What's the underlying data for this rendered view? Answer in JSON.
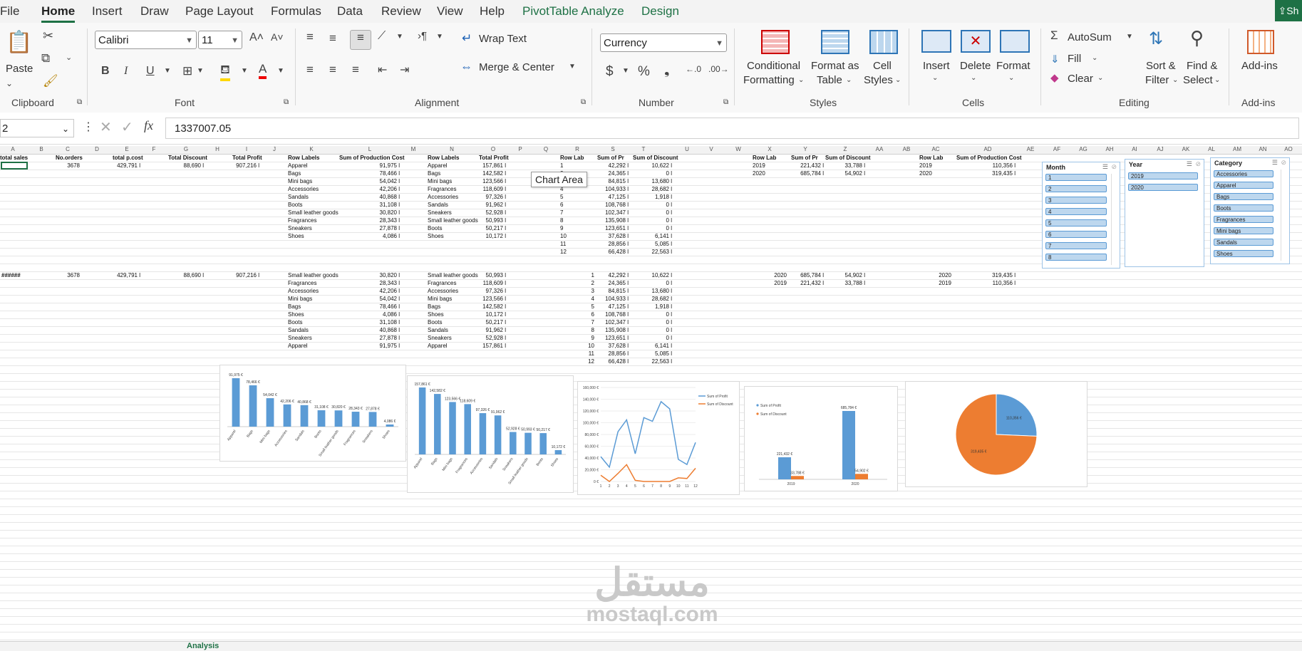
{
  "menu": {
    "items": [
      "File",
      "Home",
      "Insert",
      "Draw",
      "Page Layout",
      "Formulas",
      "Data",
      "Review",
      "View",
      "Help",
      "PivotTable Analyze",
      "Design"
    ],
    "share": "Sh"
  },
  "ribbon": {
    "clipboard": {
      "paste": "Paste",
      "label": "Clipboard"
    },
    "font": {
      "name": "Calibri",
      "size": "11",
      "label": "Font"
    },
    "alignment": {
      "wrap": "Wrap Text",
      "merge": "Merge & Center",
      "label": "Alignment"
    },
    "number": {
      "format": "Currency",
      "label": "Number"
    },
    "styles": {
      "conditional1": "Conditional",
      "conditional2": "Formatting",
      "table1": "Format as",
      "table2": "Table",
      "cell1": "Cell",
      "cell2": "Styles",
      "label": "Styles"
    },
    "cells": {
      "insert": "Insert",
      "delete": "Delete",
      "format": "Format",
      "label": "Cells"
    },
    "editing": {
      "autosum": "AutoSum",
      "fill": "Fill",
      "clear": "Clear",
      "sort1": "Sort &",
      "sort2": "Filter",
      "find1": "Find &",
      "find2": "Select",
      "label": "Editing"
    },
    "addins": {
      "button": "Add-ins",
      "label": "Add-ins"
    }
  },
  "formula_bar": {
    "namebox": "2",
    "value": "1337007.05"
  },
  "columns": [
    "A",
    "B",
    "C",
    "D",
    "E",
    "F",
    "G",
    "H",
    "I",
    "J",
    "K",
    "L",
    "M",
    "N",
    "O",
    "P",
    "Q",
    "R",
    "S",
    "T",
    "U",
    "V",
    "W",
    "X",
    "Y",
    "Z",
    "AA",
    "AB",
    "AC",
    "AD",
    "AE",
    "AF",
    "AG",
    "AH",
    "AI",
    "AJ",
    "AK",
    "AL",
    "AM",
    "AN",
    "AO"
  ],
  "summary": {
    "headers": [
      "total sales",
      "No.orders",
      "total p.cost",
      "Total Discount",
      "Total Profit"
    ],
    "row1": [
      "",
      "3678",
      "429,791 l",
      "88,690 l",
      "907,216 l"
    ],
    "row2": [
      "######",
      "3678",
      "429,791 l",
      "88,690 l",
      "907,216 l"
    ]
  },
  "pivot1": {
    "headers": [
      "Row Labels",
      "Sum of  Production Cost"
    ],
    "rows": [
      [
        "Apparel",
        "91,975 l"
      ],
      [
        "Bags",
        "78,466 l"
      ],
      [
        "Mini bags",
        "54,042 l"
      ],
      [
        "Accessories",
        "42,206 l"
      ],
      [
        "Sandals",
        "40,868 l"
      ],
      [
        "Boots",
        "31,108 l"
      ],
      [
        "Small leather goods",
        "30,820 l"
      ],
      [
        "Fragrances",
        "28,343 l"
      ],
      [
        "Sneakers",
        "27,878 l"
      ],
      [
        "Shoes",
        "4,086 l"
      ]
    ],
    "rows_sorted": [
      [
        "Small leather goods",
        "30,820 l"
      ],
      [
        "Fragrances",
        "28,343 l"
      ],
      [
        "Accessories",
        "42,206 l"
      ],
      [
        "Mini bags",
        "54,042 l"
      ],
      [
        "Bags",
        "78,466 l"
      ],
      [
        "Shoes",
        "4,086 l"
      ],
      [
        "Boots",
        "31,108 l"
      ],
      [
        "Sandals",
        "40,868 l"
      ],
      [
        "Sneakers",
        "27,878 l"
      ],
      [
        "Apparel",
        "91,975 l"
      ]
    ]
  },
  "pivot2": {
    "headers": [
      "Row Labels",
      "Total Profit"
    ],
    "rows": [
      [
        "Apparel",
        "157,861 l"
      ],
      [
        "Bags",
        "142,582 l"
      ],
      [
        "Mini bags",
        "123,566 l"
      ],
      [
        "Fragrances",
        "118,609 l"
      ],
      [
        "Accessories",
        "97,326 l"
      ],
      [
        "Sandals",
        "91,962 l"
      ],
      [
        "Sneakers",
        "52,928 l"
      ],
      [
        "Small leather goods",
        "50,993 l"
      ],
      [
        "Boots",
        "50,217 l"
      ],
      [
        "Shoes",
        "10,172 l"
      ]
    ],
    "rows_sorted": [
      [
        "Small leather goods",
        "50,993 l"
      ],
      [
        "Fragrances",
        "118,609 l"
      ],
      [
        "Accessories",
        "97,326 l"
      ],
      [
        "Mini bags",
        "123,566 l"
      ],
      [
        "Bags",
        "142,582 l"
      ],
      [
        "Shoes",
        "10,172 l"
      ],
      [
        "Boots",
        "50,217 l"
      ],
      [
        "Sandals",
        "91,962 l"
      ],
      [
        "Sneakers",
        "52,928 l"
      ],
      [
        "Apparel",
        "157,861 l"
      ]
    ]
  },
  "pivot3": {
    "headers": [
      "Row Lab",
      "Sum of Pr",
      "Sum of Discount"
    ],
    "rows": [
      [
        "1",
        "42,292 l",
        "10,622 l"
      ],
      [
        "2",
        "24,365 l",
        "0 l"
      ],
      [
        "3",
        "84,815 l",
        "13,680 l"
      ],
      [
        "4",
        "104,933 l",
        "28,682 l"
      ],
      [
        "5",
        "47,125 l",
        "1,918 l"
      ],
      [
        "6",
        "108,768 l",
        "0 l"
      ],
      [
        "7",
        "102,347 l",
        "0 l"
      ],
      [
        "8",
        "135,908 l",
        "0 l"
      ],
      [
        "9",
        "123,651 l",
        "0 l"
      ],
      [
        "10",
        "37,628 l",
        "6,141 l"
      ],
      [
        "11",
        "28,856 l",
        "5,085 l"
      ],
      [
        "12",
        "66,428 l",
        "22,563 l"
      ]
    ]
  },
  "pivot4": {
    "headers": [
      "Row Lab",
      "Sum of Pr",
      "Sum of Discount"
    ],
    "rows": [
      [
        "2019",
        "221,432 l",
        "33,788 l"
      ],
      [
        "2020",
        "685,784 l",
        "54,902 l"
      ]
    ],
    "rows2": [
      [
        "2020",
        "685,784 l",
        "54,902 l"
      ],
      [
        "2019",
        "221,432 l",
        "33,788 l"
      ]
    ]
  },
  "pivot5": {
    "headers": [
      "Row Lab",
      "Sum of  Production Cost"
    ],
    "rows": [
      [
        "2019",
        "110,356 l"
      ],
      [
        "2020",
        "319,435 l"
      ]
    ],
    "rows2": [
      [
        "2020",
        "319,435 l"
      ],
      [
        "2019",
        "110,356 l"
      ]
    ]
  },
  "tooltip": "Chart Area",
  "slicers": {
    "month": {
      "title": "Month",
      "items": [
        "1",
        "2",
        "3",
        "4",
        "5",
        "6",
        "7",
        "8"
      ]
    },
    "year": {
      "title": "Year",
      "items": [
        "2019",
        "2020"
      ]
    },
    "category": {
      "title": "Category",
      "items": [
        "Accessories",
        "Apparel",
        "Bags",
        "Boots",
        "Fragrances",
        "Mini bags",
        "Sandals",
        "Shoes"
      ]
    }
  },
  "charts": [
    {
      "type": "bar",
      "categories": [
        "Apparel",
        "Bags",
        "Mini bags",
        "Accessories",
        "Sandals",
        "Boots",
        "Small leather goods",
        "Fragrances",
        "Sneakers",
        "Shoes"
      ],
      "values": [
        91975,
        78466,
        54042,
        42206,
        40868,
        31108,
        30820,
        28343,
        27878,
        4086
      ],
      "labels": [
        "91,975 €",
        "78,466 €",
        "54,042 €",
        "42,206 €",
        "40,868 €",
        "31,108 €",
        "30,820 €",
        "28,343 €",
        "27,878 €",
        "4,086 €"
      ],
      "color": "#5b9bd5"
    },
    {
      "type": "bar",
      "categories": [
        "Apparel",
        "Bags",
        "Mini bags",
        "Fragrances",
        "Accessories",
        "Sandals",
        "Sneakers",
        "Small leather goods",
        "Boots",
        "Shoes"
      ],
      "values": [
        157861,
        142582,
        123566,
        118609,
        97326,
        91962,
        52928,
        50993,
        50217,
        10172
      ],
      "labels": [
        "157,861 €",
        "142,582 €",
        "123,566 €",
        "118,609 €",
        "97,326 €",
        "91,962 €",
        "52,928 €",
        "50,993 €",
        "50,217 €",
        "10,172 €"
      ],
      "color": "#5b9bd5"
    },
    {
      "type": "line",
      "x": [
        "1",
        "2",
        "3",
        "4",
        "5",
        "6",
        "7",
        "8",
        "9",
        "10",
        "11",
        "12"
      ],
      "series": [
        {
          "name": "Sum of Profit",
          "values": [
            42292,
            24365,
            84815,
            104933,
            47125,
            108768,
            102347,
            135908,
            123651,
            37628,
            28856,
            66428
          ],
          "color": "#5b9bd5"
        },
        {
          "name": "Sum of Discount",
          "values": [
            10622,
            0,
            13680,
            28682,
            1918,
            0,
            0,
            0,
            0,
            6141,
            5085,
            22563
          ],
          "color": "#ed7d31"
        }
      ],
      "yticks": [
        "0 €",
        "20,000 €",
        "40,000 €",
        "60,000 €",
        "80,000 €",
        "100,000 €",
        "120,000 €",
        "140,000 €",
        "160,000 €"
      ],
      "ylim": [
        0,
        160000
      ]
    },
    {
      "type": "bar",
      "categories": [
        "2019",
        "2020"
      ],
      "series": [
        {
          "name": "Sum of Profit",
          "values": [
            221432,
            685784
          ],
          "labels": [
            "221,432 €",
            "685,784 €"
          ],
          "color": "#5b9bd5"
        },
        {
          "name": "Sum of Discount",
          "values": [
            33788,
            54902
          ],
          "labels": [
            "33,788 €",
            "54,902 €"
          ],
          "color": "#ed7d31"
        }
      ]
    },
    {
      "type": "pie",
      "categories": [
        "2019",
        "2020"
      ],
      "values": [
        110356,
        319435
      ],
      "labels": [
        "110,356 €",
        "319,435 €"
      ],
      "colors": [
        "#5b9bd5",
        "#ed7d31"
      ]
    }
  ],
  "sheet_tabs": [
    "",
    "Analysis",
    "",
    ""
  ],
  "watermark": {
    "arabic": "مستقل",
    "latin": "mostaql.com"
  }
}
